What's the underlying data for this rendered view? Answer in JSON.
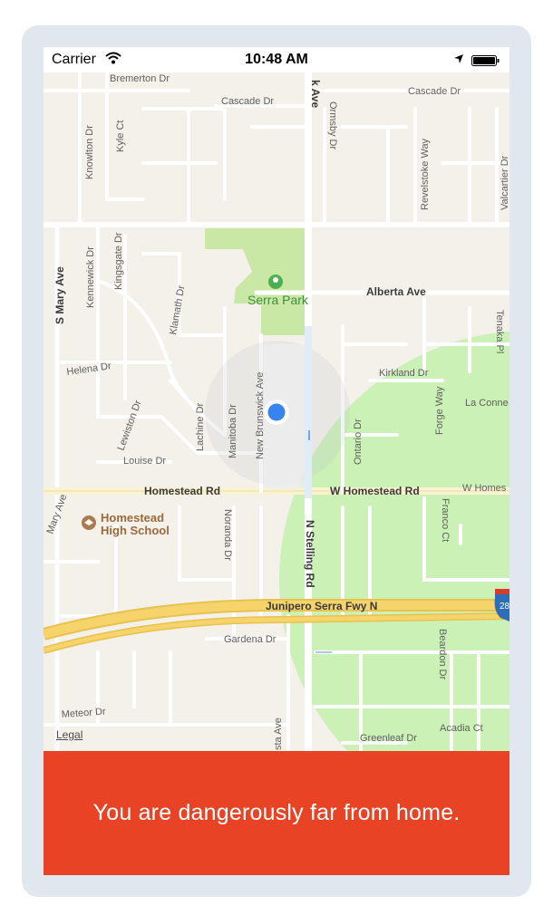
{
  "status_bar": {
    "carrier": "Carrier",
    "time": "10:48 AM",
    "icons": [
      "wifi-icon",
      "location-arrow-icon",
      "battery-icon"
    ]
  },
  "map": {
    "streets": {
      "bremerton": "Bremerton Dr",
      "cascade_1": "Cascade Dr",
      "cascade_2": "Cascade Dr",
      "k_ave": "k Ave",
      "knowlton": "Knowlton Dr",
      "kyle": "Kyle Ct",
      "ormsby": "Ormsby Dr",
      "revelstoke": "Revelstoke Way",
      "valcartier": "Valcartier Dr",
      "kennewick": "Kennewick Dr",
      "kingsgate": "Kingsgate Dr",
      "s_mary": "S Mary Ave",
      "klamath": "Klamath Dr",
      "alberta": "Alberta Ave",
      "tenaka": "Tenaka Pl",
      "helena": "Helena Dr",
      "kirkland": "Kirkland Dr",
      "la_conne": "La Conne",
      "lewiston": "Lewiston Dr",
      "lachine": "Lachine Dr",
      "manitoba": "Manitoba Dr",
      "new_brunswick": "New Brunswick Ave",
      "ontario": "Ontario Dr",
      "louise": "Louise Dr",
      "homestead": "Homestead Rd",
      "w_homestead_1": "W Homestead Rd",
      "w_homestead_2": "W Homes",
      "forge": "Forge Way",
      "franco": "Franco Ct",
      "mary_ave": "Mary Ave",
      "noranda": "Noranda Dr",
      "n_stelling": "N Stelling Rd",
      "junipero": "Junipero Serra Fwy N",
      "beardon": "Beardon Dr",
      "gardena": "Gardena Dr",
      "meteor": "Meteor Dr",
      "greenleaf": "Greenleaf Dr",
      "acadia": "Acadia Ct",
      "sta_ave": "sta Ave"
    },
    "poi": {
      "park": "Serra Park",
      "school_line1": "Homestead",
      "school_line2": "High School"
    },
    "highway_shield": "28",
    "colors": {
      "land": "#f4f1ea",
      "park": "#c9e8a5",
      "geofence": "#c8f0b4",
      "user_dot": "#3a84f0",
      "freeway": "#f6d46b"
    },
    "legal": "Legal"
  },
  "alert": {
    "message": "You are dangerously far from home.",
    "color": "#e94325"
  }
}
